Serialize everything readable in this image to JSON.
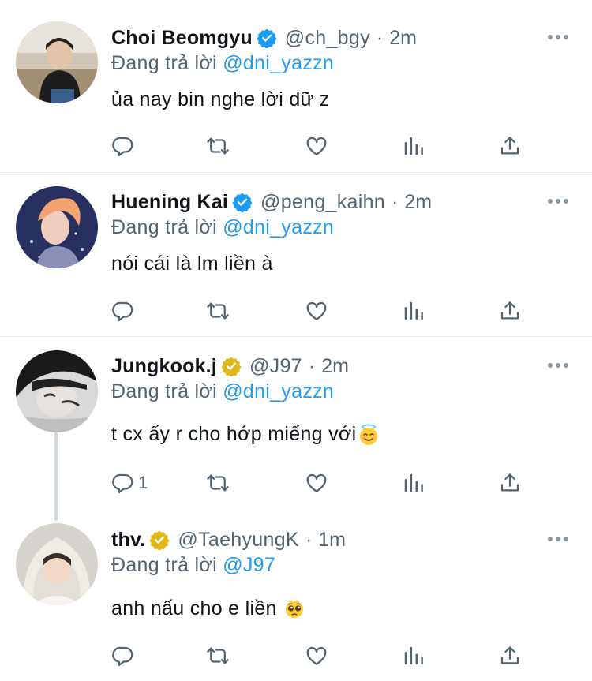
{
  "reply_prefix": "Đang trả lời",
  "tweets": [
    {
      "name": "Choi Beomgyu",
      "verified": "blue",
      "handle": "@ch_bgy",
      "time": "2m",
      "reply_to": "@dni_yazzn",
      "text": "ủa nay bin nghe lời dữ z",
      "emoji": "",
      "reply_count": "",
      "avatar_icon": "avatar-choi-beomgyu"
    },
    {
      "name": "Huening Kai",
      "verified": "blue",
      "handle": "@peng_kaihn",
      "time": "2m",
      "reply_to": "@dni_yazzn",
      "text": "nói cái là lm liền à",
      "emoji": "",
      "reply_count": "",
      "avatar_icon": "avatar-huening-kai"
    },
    {
      "name": "Jungkook.j",
      "verified": "gold",
      "handle": "@J97",
      "time": "2m",
      "reply_to": "@dni_yazzn",
      "text": "t cx ấy r cho hớp miếng với",
      "emoji": "smiling-face-with-halo",
      "reply_count": "1",
      "avatar_icon": "avatar-jungkook"
    },
    {
      "name": "thv.",
      "verified": "gold",
      "handle": "@TaehyungK",
      "time": "1m",
      "reply_to": "@J97",
      "text": "anh nấu cho e liền",
      "emoji": "pleading-face",
      "reply_count": "",
      "avatar_icon": "avatar-thv"
    }
  ],
  "colors": {
    "link": "#1d9bf0",
    "secondary_text": "#536471",
    "verified_blue": "#1d9bf0",
    "verified_gold": "#e2b719",
    "divider": "#e6ecf0"
  },
  "action_icons": [
    "reply-icon",
    "retweet-icon",
    "like-icon",
    "analytics-icon",
    "share-icon"
  ]
}
